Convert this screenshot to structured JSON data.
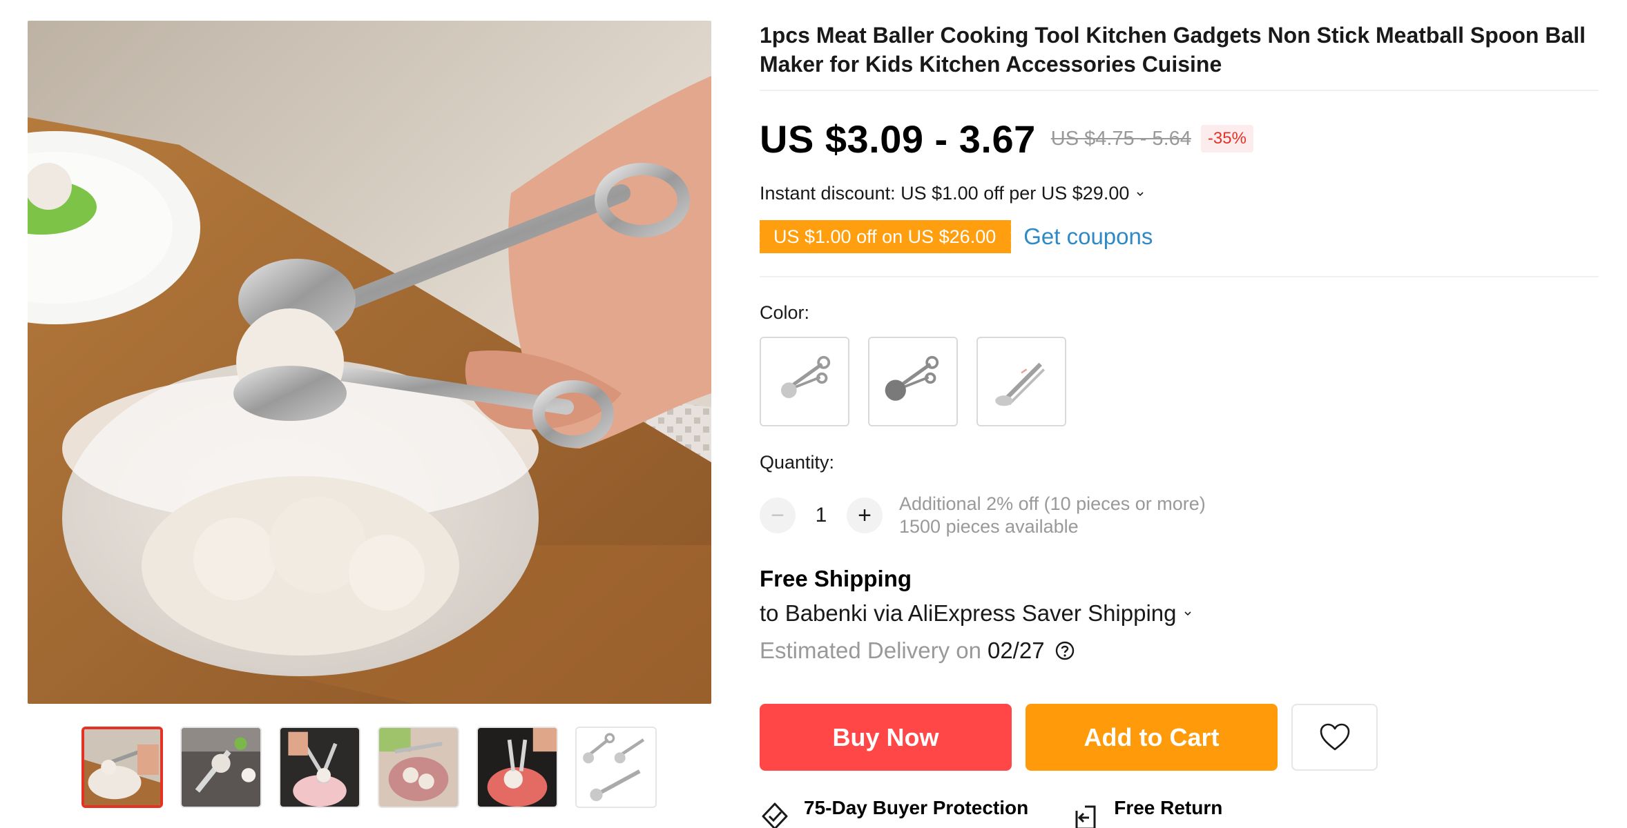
{
  "product": {
    "title": "1pcs Meat Baller Cooking Tool Kitchen Gadgets Non Stick Meatball Spoon Ball Maker for Kids Kitchen Accessories Cuisine"
  },
  "gallery": {
    "thumbnail_count": 6,
    "active_thumbnail": 1
  },
  "price": {
    "current": "US $3.09 - 3.67",
    "original": "US $4.75 - 5.64",
    "discount": "-35%"
  },
  "promotions": {
    "instant_discount": "Instant discount: US $1.00 off per US $29.00",
    "coupon": "US $1.00 off on US $26.00",
    "get_coupons": "Get coupons"
  },
  "color": {
    "label": "Color:",
    "option_count": 3
  },
  "quantity": {
    "label": "Quantity:",
    "value": "1",
    "minus": "−",
    "plus": "+",
    "bulk_note": "Additional 2% off (10 pieces or more)",
    "available": "1500 pieces available"
  },
  "shipping": {
    "title": "Free Shipping",
    "via": "to Babenki via AliExpress Saver Shipping",
    "delivery_label": "Estimated Delivery on",
    "delivery_date": "02/27"
  },
  "actions": {
    "buy_now": "Buy Now",
    "add_to_cart": "Add to Cart"
  },
  "features": {
    "protection": "75-Day Buyer Protection",
    "free_return": "Free Return"
  },
  "colors": {
    "buy_now": "#ff4747",
    "add_to_cart": "#ff9a0a",
    "coupon": "#ff9e0f",
    "link": "#2e8ac6",
    "discount_red": "#e43225"
  }
}
